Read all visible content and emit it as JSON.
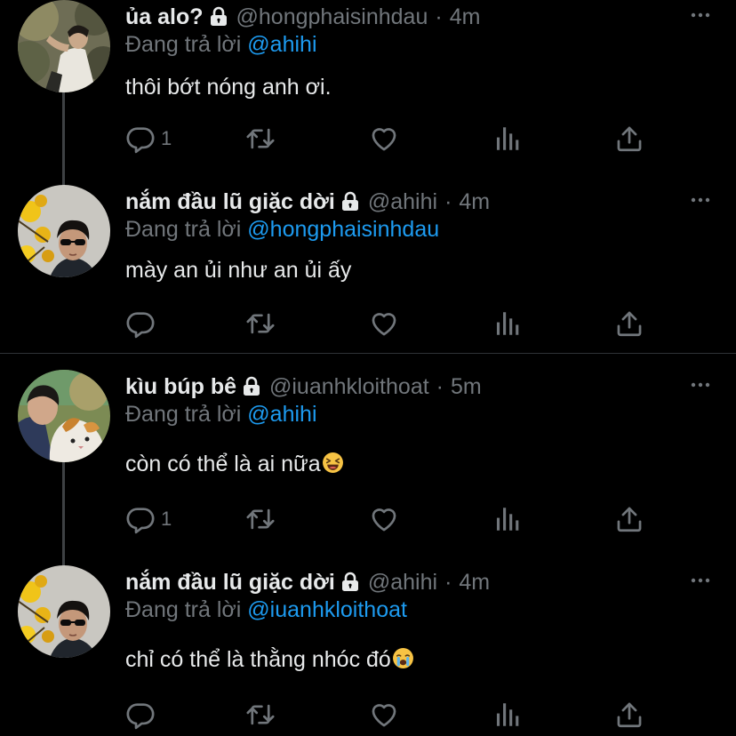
{
  "tweets": [
    {
      "display_name": "ủa alo?",
      "handle": "@hongphaisinhdau",
      "dot": "·",
      "time": "4m",
      "reply_prefix": "Đang trả lời",
      "reply_to": "@ahihi",
      "text": "thôi bớt nóng anh ơi.",
      "reply_count": "1",
      "avatar": "person-in-trees"
    },
    {
      "display_name": "nắm đầu lũ giặc dời",
      "handle": "@ahihi",
      "dot": "·",
      "time": "4m",
      "reply_prefix": "Đang trả lời",
      "reply_to": "@hongphaisinhdau",
      "text": "mày an ủi như an ủi ấy",
      "reply_count": "",
      "avatar": "sunglasses-yellow-flowers"
    },
    {
      "display_name": "kìu búp bê",
      "handle": "@iuanhkloithoat",
      "dot": "·",
      "time": "5m",
      "reply_prefix": "Đang trả lời",
      "reply_to": "@ahihi",
      "text": "còn có thể là ai nữa",
      "emoji": "laughing-face",
      "reply_count": "1",
      "avatar": "person-with-cat"
    },
    {
      "display_name": "nắm đầu lũ giặc dời",
      "handle": "@ahihi",
      "dot": "·",
      "time": "4m",
      "reply_prefix": "Đang trả lời",
      "reply_to": "@iuanhkloithoat",
      "text": "chỉ có thể là thằng nhóc đó",
      "emoji": "crying-face",
      "reply_count": "",
      "avatar": "sunglasses-yellow-flowers"
    }
  ],
  "icons": {
    "lock": "lock-icon",
    "more": "more-icon",
    "reply": "reply-icon",
    "retweet": "retweet-icon",
    "like": "like-icon",
    "analytics": "analytics-icon",
    "share": "share-icon"
  },
  "colors": {
    "background": "#000000",
    "text": "#e7e9ea",
    "secondary": "#71767b",
    "link": "#1d9bf0",
    "thread_line": "#3e4144",
    "divider": "#2f3336"
  }
}
